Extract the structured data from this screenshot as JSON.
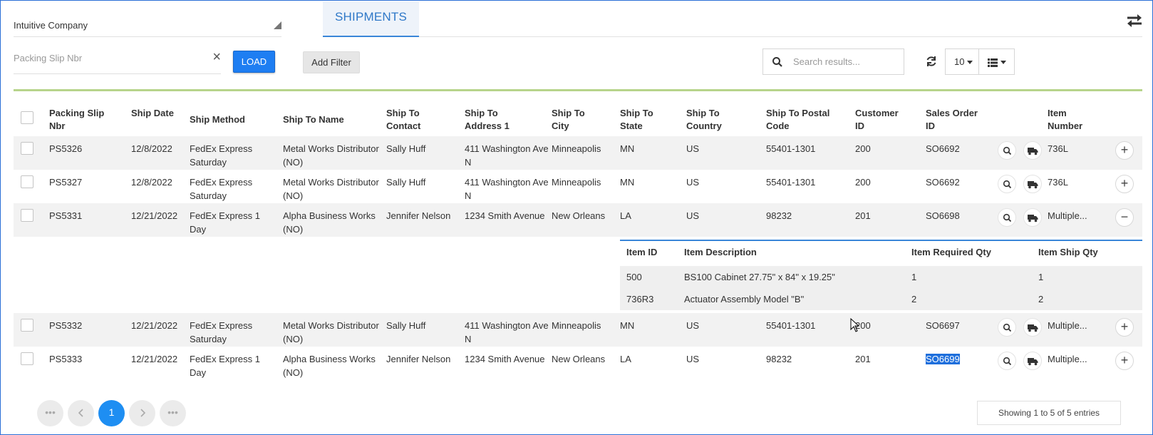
{
  "company": {
    "value": "Intuitive Company"
  },
  "packing_slip": {
    "placeholder": "Packing Slip Nbr",
    "clear_icon": "close-icon"
  },
  "load_label": "LOAD",
  "tab_label": "SHIPMENTS",
  "add_filter_label": "Add Filter",
  "search": {
    "placeholder": "Search results..."
  },
  "page_size": "10",
  "columns": [
    "Packing Slip Nbr",
    "Ship Date",
    "Ship Method",
    "Ship To Name",
    "Ship To Contact",
    "Ship To Address 1",
    "Ship To City",
    "Ship To State",
    "Ship To Country",
    "Ship To Postal Code",
    "Customer ID",
    "Sales Order ID",
    "Item Number"
  ],
  "rows": [
    {
      "slip": "PS5326",
      "date": "12/8/2022",
      "method": "FedEx Express Saturday",
      "name": "Metal Works Distributor (NO)",
      "contact": "Sally Huff",
      "address": "411 Washington Ave N",
      "city": "Minneapolis",
      "state": "MN",
      "country": "US",
      "postal": "55401-1301",
      "customer": "200",
      "order": "SO6692",
      "item": "736L",
      "expand": "+"
    },
    {
      "slip": "PS5327",
      "date": "12/8/2022",
      "method": "FedEx Express Saturday",
      "name": "Metal Works Distributor (NO)",
      "contact": "Sally Huff",
      "address": "411 Washington Ave N",
      "city": "Minneapolis",
      "state": "MN",
      "country": "US",
      "postal": "55401-1301",
      "customer": "200",
      "order": "SO6692",
      "item": "736L",
      "expand": "+"
    },
    {
      "slip": "PS5331",
      "date": "12/21/2022",
      "method": "FedEx Express 1 Day",
      "name": "Alpha Business Works (NO)",
      "contact": "Jennifer Nelson",
      "address": "1234 Smith Avenue",
      "city": "New Orleans",
      "state": "LA",
      "country": "US",
      "postal": "98232",
      "customer": "201",
      "order": "SO6698",
      "item": "Multiple...",
      "expand": "−"
    },
    {
      "slip": "PS5332",
      "date": "12/21/2022",
      "method": "FedEx Express Saturday",
      "name": "Metal Works Distributor (NO)",
      "contact": "Sally Huff",
      "address": "411 Washington Ave N",
      "city": "Minneapolis",
      "state": "MN",
      "country": "US",
      "postal": "55401-1301",
      "customer": "200",
      "order": "SO6697",
      "item": "Multiple...",
      "expand": "+"
    },
    {
      "slip": "PS5333",
      "date": "12/21/2022",
      "method": "FedEx Express 1 Day",
      "name": "Alpha Business Works (NO)",
      "contact": "Jennifer Nelson",
      "address": "1234 Smith Avenue",
      "city": "New Orleans",
      "state": "LA",
      "country": "US",
      "postal": "98232",
      "customer": "201",
      "order": "SO6699",
      "item": "Multiple...",
      "expand": "+"
    }
  ],
  "detail": {
    "columns": [
      "Item ID",
      "Item Description",
      "Item Required Qty",
      "Item Ship Qty"
    ],
    "rows": [
      {
        "id": "500",
        "desc": "BS100 Cabinet 27.75\" x 84\" x 19.25\"",
        "req": "1",
        "ship": "1"
      },
      {
        "id": "736R3",
        "desc": "Actuator Assembly Model \"B\"",
        "req": "2",
        "ship": "2"
      }
    ]
  },
  "pagination": {
    "current": "1",
    "more_label": "•••"
  },
  "showing": "Showing 1 to 5 of 5 entries",
  "colors": {
    "accent": "#1e7ef2",
    "tab_text": "#2f78c8",
    "divider_green": "#b7d48b",
    "selection": "#1e6fdc"
  }
}
